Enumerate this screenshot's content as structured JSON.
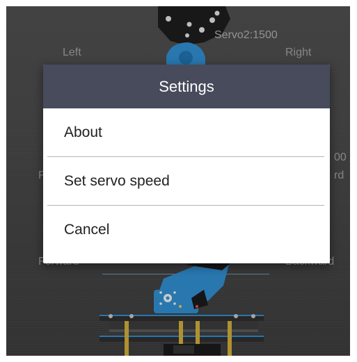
{
  "background": {
    "servo_readout": "Servo2:1500",
    "servo_readout_right_partial": "00",
    "left_label": "Left",
    "right_label": "Right",
    "forward_label": "Forward",
    "backward_label": "Backward",
    "right_side_partial": "rd",
    "left_side_partial": "F"
  },
  "dialog": {
    "title": "Settings",
    "options": [
      {
        "label": "About"
      },
      {
        "label": "Set servo speed"
      },
      {
        "label": "Cancel"
      }
    ]
  },
  "colors": {
    "dialog_header": "#474b5c",
    "dialog_body": "#ffffff",
    "servo_blue": "#2f88c8",
    "background": "#454545"
  }
}
